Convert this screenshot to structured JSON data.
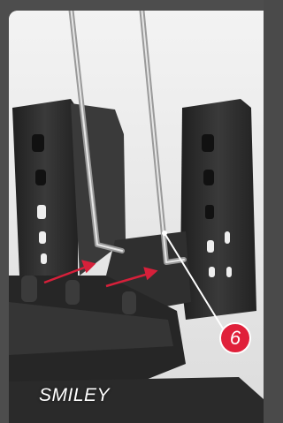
{
  "photo": {
    "caption": "SMILEY",
    "callout_number": "6"
  },
  "colors": {
    "frame": "#4d4d4d",
    "background": "#e9e9e9",
    "plastic": "#2b2b2b",
    "wire": "#9a9a9a",
    "arrow": "#d6203a",
    "callout": "#e0203a"
  },
  "icons": {
    "callout": "numbered-callout-badge",
    "arrows": "red-pointer-arrow"
  }
}
